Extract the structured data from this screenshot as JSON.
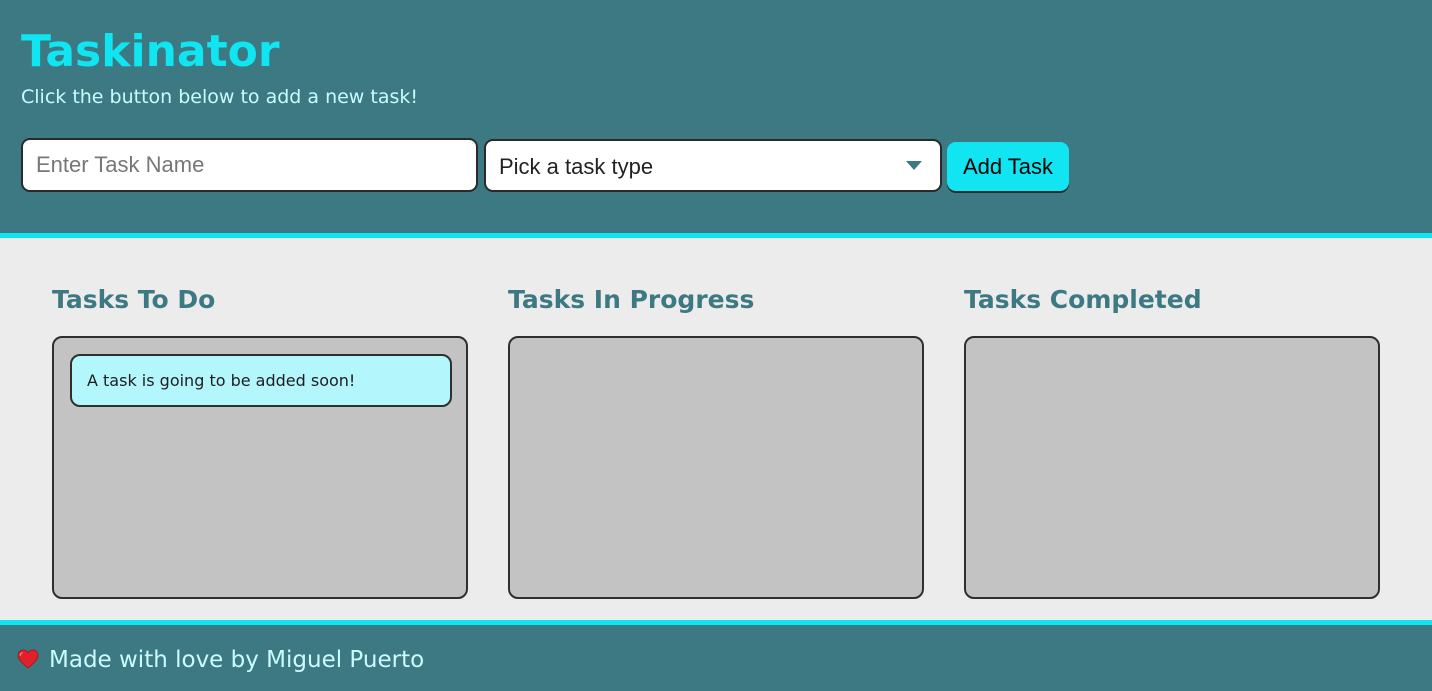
{
  "header": {
    "title": "Taskinator",
    "subtitle": "Click the button below to add a new task!"
  },
  "form": {
    "task_name_placeholder": "Enter Task Name",
    "task_name_value": "",
    "task_type_selected": "Pick a task type",
    "add_button_label": "Add Task"
  },
  "columns": [
    {
      "title": "Tasks To Do",
      "tasks": [
        "A task is going to be added soon!"
      ]
    },
    {
      "title": "Tasks In Progress",
      "tasks": []
    },
    {
      "title": "Tasks Completed",
      "tasks": []
    }
  ],
  "footer": {
    "icon": "heart-icon",
    "text": "Made with love by Miguel Puerto"
  },
  "colors": {
    "header_bg": "#3d7982",
    "accent": "#10e5f1",
    "page_bg": "#ececec",
    "list_bg": "#c3c3c3",
    "task_bg": "#b3f6fc",
    "heart": "#e0202a"
  }
}
